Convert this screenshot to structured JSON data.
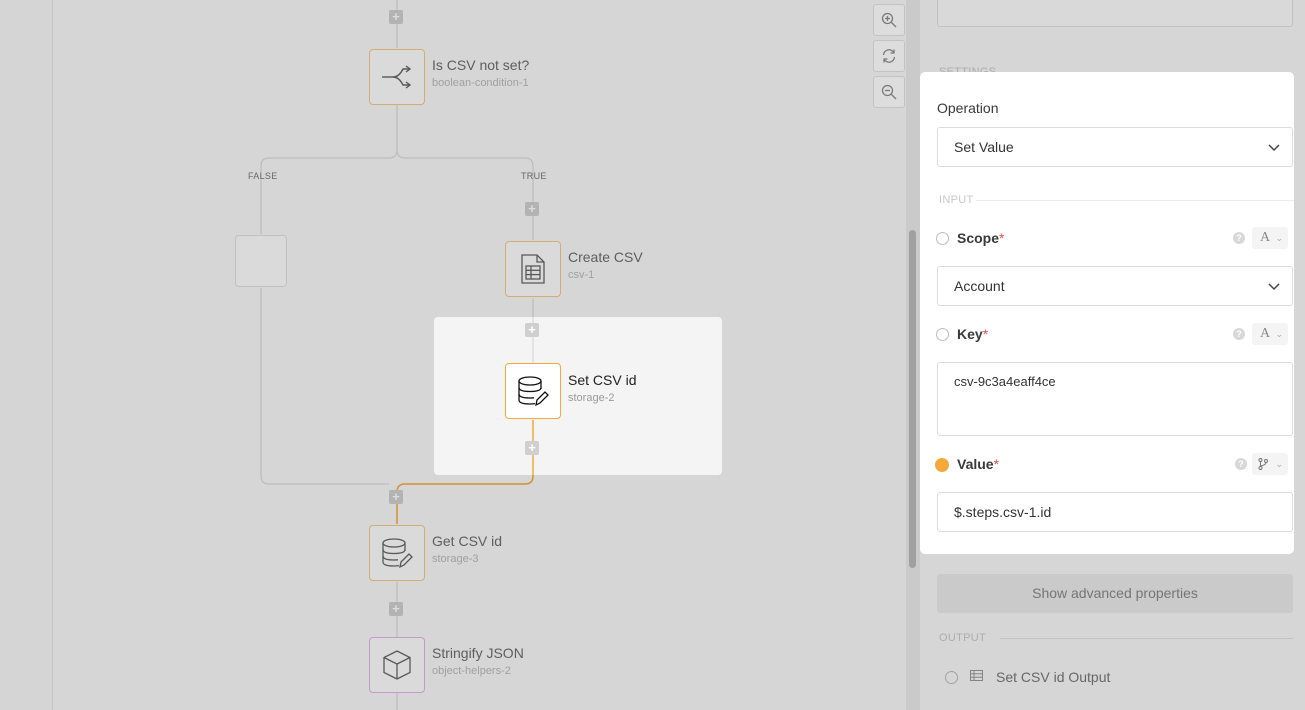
{
  "canvas": {
    "nodes": [
      {
        "title": "Is CSV not set?",
        "subtitle": "boolean-condition-1",
        "icon": "branch-icon"
      },
      {
        "title": "Create CSV",
        "subtitle": "csv-1",
        "icon": "spreadsheet-icon"
      },
      {
        "title": "Set CSV id",
        "subtitle": "storage-2",
        "icon": "database-edit-icon"
      },
      {
        "title": "Get CSV id",
        "subtitle": "storage-3",
        "icon": "database-edit-icon"
      },
      {
        "title": "Stringify JSON",
        "subtitle": "object-helpers-2",
        "icon": "cube-icon"
      }
    ],
    "branch_false": "FALSE",
    "branch_true": "TRUE",
    "accent": "#f4a93a"
  },
  "zoom_controls": {
    "zoom_in": "zoom-in-icon",
    "reset": "refresh-icon",
    "zoom_out": "zoom-out-icon"
  },
  "panel": {
    "settings_heading": "SETTINGS",
    "operation_label": "Operation",
    "operation_value": "Set Value",
    "input_heading": "INPUT",
    "scope": {
      "name": "Scope",
      "value": "Account",
      "type": "A"
    },
    "key": {
      "name": "Key",
      "value": "csv-9c3a4eaff4ce",
      "type": "A"
    },
    "value": {
      "name": "Value",
      "value": "$.steps.csv-1.id"
    },
    "required_mark": "*",
    "help_mark": "?",
    "advanced_button": "Show advanced properties",
    "output_heading": "OUTPUT",
    "output_item": "Set CSV id Output"
  }
}
